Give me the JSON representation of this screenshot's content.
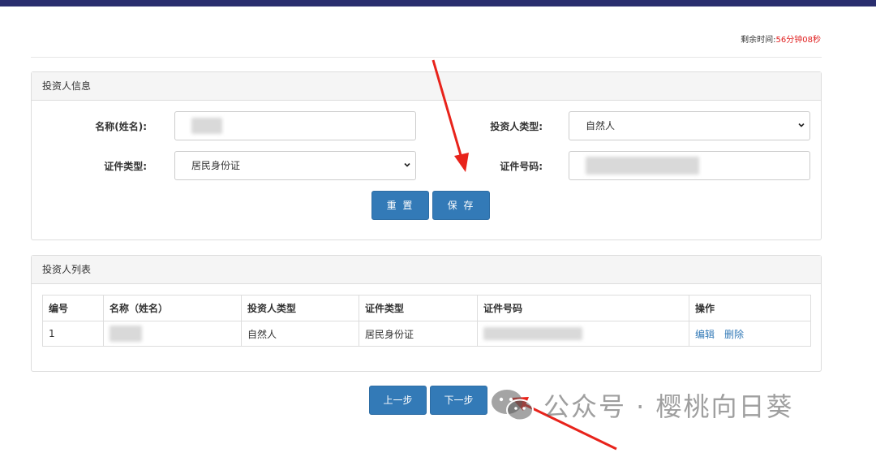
{
  "timer": {
    "label": "剩余时间:",
    "value": "56分钟08秒"
  },
  "info_panel": {
    "title": "投资人信息",
    "name_label": "名称(姓名):",
    "name_value": "",
    "investor_type_label": "投资人类型:",
    "investor_type_value": "自然人",
    "id_type_label": "证件类型:",
    "id_type_value": "居民身份证",
    "id_number_label": "证件号码:",
    "id_number_value": "",
    "reset_label": "重 置",
    "save_label": "保 存"
  },
  "list_panel": {
    "title": "投资人列表",
    "columns": [
      "编号",
      "名称（姓名）",
      "投资人类型",
      "证件类型",
      "证件号码",
      "操作"
    ],
    "rows": [
      {
        "no": "1",
        "name": "",
        "investor_type": "自然人",
        "id_type": "居民身份证",
        "id_number": "",
        "edit": "编辑",
        "delete": "删除"
      }
    ]
  },
  "nav": {
    "prev_label": "上一步",
    "next_label": "下一步"
  },
  "watermark": {
    "text": "公众号 · 樱桃向日葵"
  },
  "colors": {
    "primary": "#337ab7",
    "topbar": "#2a2e6e",
    "timer_red": "#e02020",
    "arrow_red": "#e8231b"
  }
}
